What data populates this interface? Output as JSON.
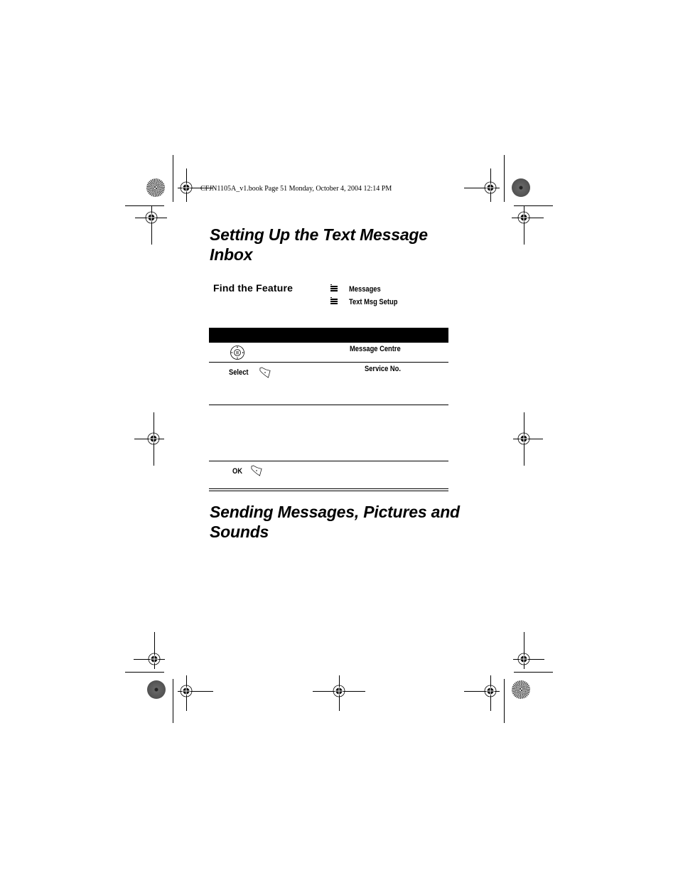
{
  "print_header": "CFJN1105A_v1.book  Page 51  Monday, October 4, 2004  12:14 PM",
  "section1": {
    "title_line1": "Setting Up the Text Message",
    "title_line2": "Inbox"
  },
  "find_feature": {
    "label": "Find the Feature",
    "path": [
      {
        "icon": "menu-key-icon",
        "label": "Messages"
      },
      {
        "icon": "menu-key-icon",
        "label": "Text Msg Setup"
      }
    ]
  },
  "steps": [
    {
      "action_icon": "nav-key-icon",
      "action_label": "",
      "detail": "Message Centre"
    },
    {
      "action_icon": "soft-key-icon",
      "action_label": "Select",
      "detail": "Service No."
    },
    {
      "action_icon": "",
      "action_label": "",
      "detail": ""
    },
    {
      "action_icon": "soft-key-icon",
      "action_label": "OK",
      "detail": ""
    }
  ],
  "section2": {
    "title_line1": "Sending Messages, Pictures and",
    "title_line2": "Sounds"
  }
}
